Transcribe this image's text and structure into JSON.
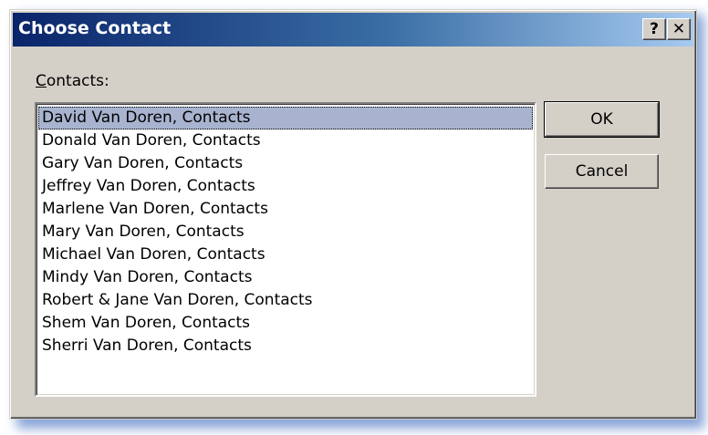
{
  "window": {
    "title": "Choose Contact",
    "help_glyph": "?",
    "close_glyph": "✕"
  },
  "contacts": {
    "label": "Contacts:",
    "selected_index": 0,
    "items": [
      "David Van Doren, Contacts",
      "Donald Van Doren, Contacts",
      "Gary Van Doren, Contacts",
      "Jeffrey Van Doren, Contacts",
      "Marlene Van Doren, Contacts",
      "Mary Van Doren, Contacts",
      "Michael Van Doren, Contacts",
      "Mindy Van Doren, Contacts",
      "Robert & Jane Van Doren, Contacts",
      "Shem Van Doren, Contacts",
      "Sherri Van Doren, Contacts"
    ]
  },
  "buttons": {
    "ok_label": "OK",
    "cancel_label": "Cancel"
  },
  "colors": {
    "title_gradient_start": "#0a246a",
    "title_gradient_end": "#a6caf0",
    "selection": "#a8b3cf",
    "face": "#d4d0c8"
  }
}
